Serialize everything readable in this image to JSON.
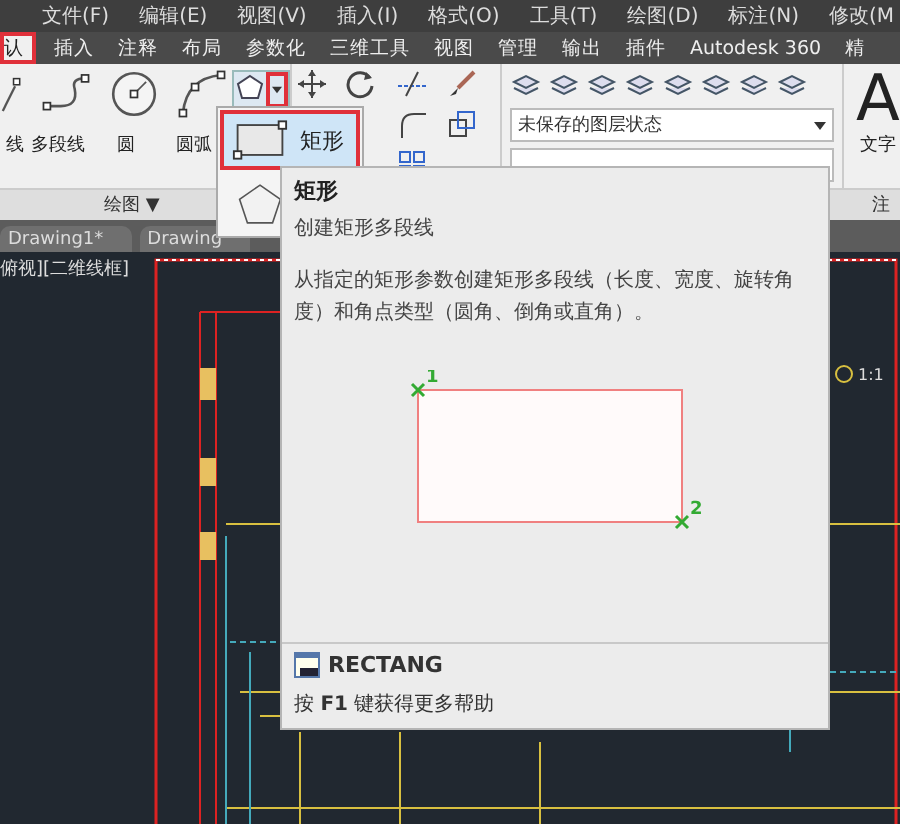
{
  "menu": [
    "文件(F)",
    "编辑(E)",
    "视图(V)",
    "插入(I)",
    "格式(O)",
    "工具(T)",
    "绘图(D)",
    "标注(N)",
    "修改(M"
  ],
  "ribbon_tabs": [
    {
      "label": "认",
      "selected": true,
      "highlighted": true
    },
    {
      "label": "插入",
      "selected": false,
      "highlighted": false
    },
    {
      "label": "注释",
      "selected": false,
      "highlighted": false
    },
    {
      "label": "布局",
      "selected": false,
      "highlighted": false
    },
    {
      "label": "参数化",
      "selected": false,
      "highlighted": false
    },
    {
      "label": "三维工具",
      "selected": false,
      "highlighted": false
    },
    {
      "label": "视图",
      "selected": false,
      "highlighted": false
    },
    {
      "label": "管理",
      "selected": false,
      "highlighted": false
    },
    {
      "label": "输出",
      "selected": false,
      "highlighted": false
    },
    {
      "label": "插件",
      "selected": false,
      "highlighted": false
    },
    {
      "label": "Autodesk 360",
      "selected": false,
      "highlighted": false
    },
    {
      "label": "精",
      "selected": false,
      "highlighted": false
    }
  ],
  "draw_tools": [
    {
      "kind": "line",
      "label": "线"
    },
    {
      "kind": "polyline",
      "label": "多段线"
    },
    {
      "kind": "circle",
      "label": "圆"
    },
    {
      "kind": "arc",
      "label": "圆弧"
    }
  ],
  "polygon_button": {
    "arrow_highlighted": true
  },
  "layer_state": {
    "value": "未保存的图层状态"
  },
  "text_tool": {
    "glyph": "A",
    "label": "文字"
  },
  "panel_labels": {
    "draw": "绘图 ▼",
    "annotation": "注"
  },
  "doc_tabs": [
    {
      "label": "Drawing1*"
    },
    {
      "label": "Drawing"
    }
  ],
  "viewport": {
    "label": "俯视][二维线框]",
    "scale": "1:1"
  },
  "dropdown": [
    {
      "kind": "rectangle",
      "label": "矩形",
      "selected": true,
      "highlighted": true
    },
    {
      "kind": "polygon",
      "selected": false,
      "highlighted": false
    }
  ],
  "tooltip": {
    "title": "矩形",
    "subtitle": "创建矩形多段线",
    "description": "从指定的矩形参数创建矩形多段线（长度、宽度、旋转角度）和角点类型（圆角、倒角或直角）。",
    "points": [
      "1",
      "2"
    ],
    "command": "RECTANG",
    "help": "按 **F1** 键获得更多帮助"
  }
}
